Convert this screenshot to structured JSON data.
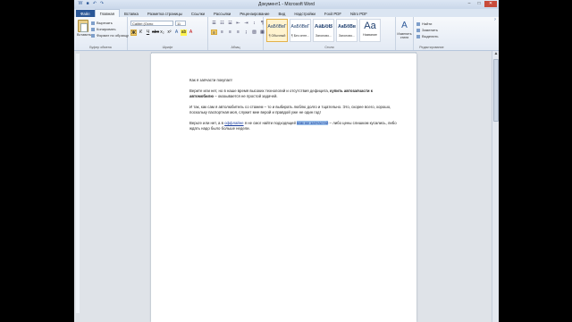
{
  "title": "Документ1 - Microsoft Word",
  "tabs": [
    "Файл",
    "Главная",
    "Вставка",
    "Разметка страницы",
    "Ссылки",
    "Рассылки",
    "Рецензирование",
    "Вид",
    "Надстройки",
    "Foxit PDF",
    "Nitro PDF",
    "Акробат",
    "Fishing (GREC2)"
  ],
  "clipboard": {
    "paste_label": "Вставить",
    "items": [
      "Вырезать",
      "Копировать",
      "Формат по образцу"
    ],
    "group_name": "Буфер обмена"
  },
  "font": {
    "family": "Calibri (Осно",
    "size": "11",
    "group_name": "Шрифт"
  },
  "paragraph": {
    "group_name": "Абзац"
  },
  "styles": {
    "items": [
      {
        "sample": "АаБбВвГ",
        "name": "¶ Обычный"
      },
      {
        "sample": "АаБбВвГ",
        "name": "¶ Без инте..."
      },
      {
        "sample": "АаБбВ",
        "name": "Заголово..."
      },
      {
        "sample": "АаБбВв",
        "name": "Заголово..."
      },
      {
        "sample": "Аа",
        "name": "Название"
      }
    ],
    "change_label": "Изменить стили",
    "group_name": "Стили"
  },
  "editing": {
    "items": [
      "Найти",
      "Заменить",
      "Выделить"
    ],
    "group_name": "Редактирование"
  },
  "document": {
    "p1": "Как я запчасти покупал!",
    "p2_a": "Верите или нет, но в наше время высоких технологий и отсутствия дефицита, ",
    "p2_b": "купить автозапчасти к автомобилю",
    "p2_c": " – оказывается не простой задачей.",
    "p3": "И так, как сам я автолюбитель со стажем – то и выбирать люблю долго и тщательно. Это, скорее всего, хорошо, поскольку паспортная моя, служит мне верой и правдой уже не один год!",
    "p4_a": "Верьте или нет, а в ",
    "p4_link": "оффлайне",
    "p4_b": " я не смог найти подходящей ",
    "p4_sel": "вам же запчастей",
    "p4_c": " – либо цены слишком кусались, либо ждать надо было больше недели."
  }
}
